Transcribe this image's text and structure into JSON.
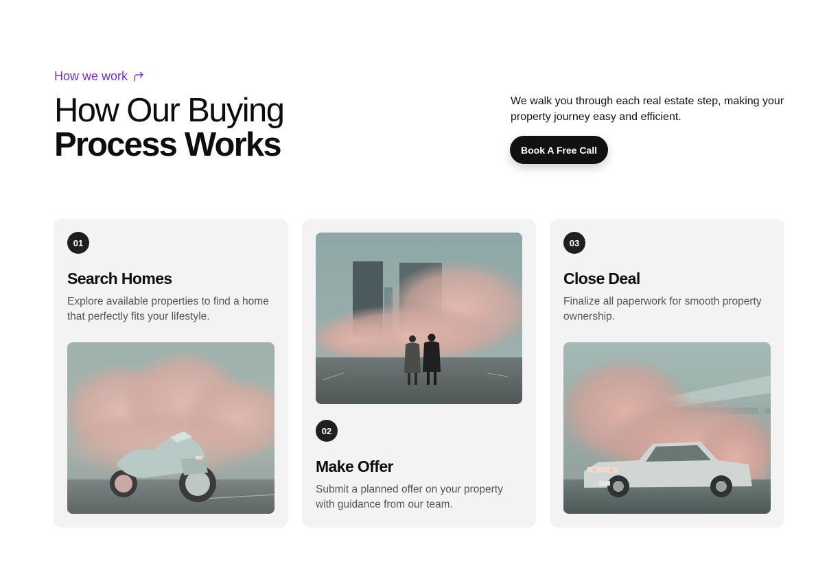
{
  "header": {
    "eyebrow": "How we work",
    "eyebrow_icon": "arrow-turn-right-icon",
    "title_line1": "How Our Buying",
    "title_line2": "Process Works",
    "intro": "We walk you through each real estate step, making your property journey easy and efficient.",
    "cta_label": "Book A Free Call"
  },
  "colors": {
    "accent": "#7a2fd0",
    "card_bg": "#f3f3f3",
    "button_bg": "#111111"
  },
  "steps": [
    {
      "number": "01",
      "title": "Search Homes",
      "description": "Explore available properties to find a home that perfectly fits your lifestyle.",
      "image": "motorcycle-in-pink-fog"
    },
    {
      "number": "02",
      "title": "Make Offer",
      "description": "Submit a planned offer on your property with guidance from our team.",
      "image": "couple-walking-toward-city-fog"
    },
    {
      "number": "03",
      "title": "Close Deal",
      "description": "Finalize all paperwork for smooth property ownership.",
      "image": "car-in-carport-pink-smoke"
    }
  ]
}
